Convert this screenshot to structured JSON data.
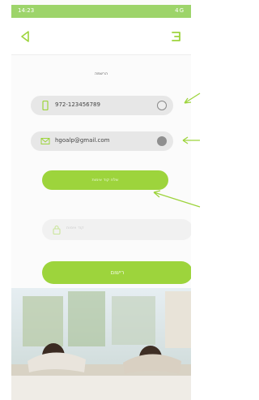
{
  "status_bar": {
    "time": "14:23",
    "icons": "4G"
  },
  "header": {
    "back_icon": "back-arrow-icon",
    "menu_icon": "menu-icon"
  },
  "form": {
    "title": "הרשמה",
    "phone": {
      "value": "972-123456789",
      "icon": "phone-icon"
    },
    "email": {
      "value": "hgoalp@gmail.com",
      "icon": "mail-icon"
    },
    "send_code_label": "שלח קוד אימות",
    "code_placeholder": "קוד אימות",
    "register_label": "רישום"
  },
  "colors": {
    "brand": "#9dd43c",
    "field_bg": "#e7e7e7"
  }
}
